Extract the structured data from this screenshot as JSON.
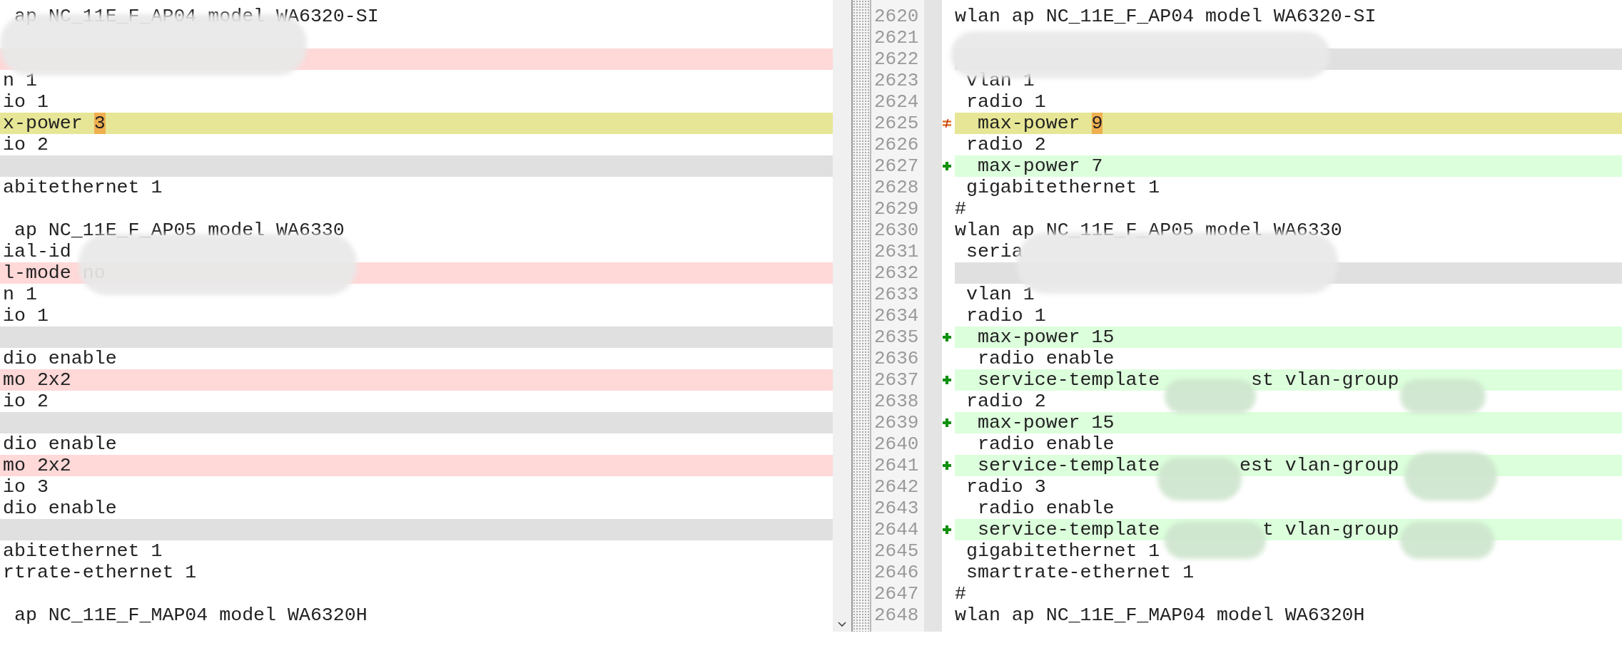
{
  "left_pane": {
    "lines": [
      {
        "kind": "equal",
        "text": " ap NC_11E_F_AP04 model WA6320-SI"
      },
      {
        "kind": "equal"
      },
      {
        "kind": "removed"
      },
      {
        "kind": "equal",
        "text": "n 1"
      },
      {
        "kind": "equal",
        "text": "io 1"
      },
      {
        "kind": "changed",
        "text": "x-power ",
        "changed_text": "3"
      },
      {
        "kind": "equal",
        "text": "io 2"
      },
      {
        "kind": "placeholder"
      },
      {
        "kind": "equal",
        "text": "abitethernet 1"
      },
      {
        "kind": "equal"
      },
      {
        "kind": "equal",
        "text": " ap NC_11E_F_AP05 model WA6330"
      },
      {
        "kind": "equal",
        "text": "ial-id"
      },
      {
        "kind": "removed",
        "text": "l-mode no"
      },
      {
        "kind": "equal",
        "text": "n 1"
      },
      {
        "kind": "equal",
        "text": "io 1"
      },
      {
        "kind": "placeholder"
      },
      {
        "kind": "equal",
        "text": "dio enable"
      },
      {
        "kind": "removed",
        "text": "mo 2x2"
      },
      {
        "kind": "equal",
        "text": "io 2"
      },
      {
        "kind": "placeholder"
      },
      {
        "kind": "equal",
        "text": "dio enable"
      },
      {
        "kind": "removed",
        "text": "mo 2x2"
      },
      {
        "kind": "equal",
        "text": "io 3"
      },
      {
        "kind": "equal",
        "text": "dio enable"
      },
      {
        "kind": "placeholder"
      },
      {
        "kind": "equal",
        "text": "abitethernet 1"
      },
      {
        "kind": "equal",
        "text": "rtrate-ethernet 1"
      },
      {
        "kind": "equal"
      },
      {
        "kind": "equal",
        "text": " ap NC_11E_F_MAP04 model WA6320H"
      }
    ]
  },
  "right_pane": {
    "lines": [
      {
        "number": "2620",
        "kind": "equal",
        "text": "wlan ap NC_11E_F_AP04 model WA6320-SI"
      },
      {
        "number": "2621",
        "kind": "equal"
      },
      {
        "number": "2622",
        "kind": "placeholder"
      },
      {
        "number": "2623",
        "kind": "equal",
        "text": " vlan 1"
      },
      {
        "number": "2624",
        "kind": "equal",
        "text": " radio 1"
      },
      {
        "number": "2625",
        "kind": "changed",
        "text": "  max-power ",
        "changed_text": "9"
      },
      {
        "number": "2626",
        "kind": "equal",
        "text": " radio 2"
      },
      {
        "number": "2627",
        "kind": "added",
        "text": "  max-power 7"
      },
      {
        "number": "2628",
        "kind": "equal",
        "text": " gigabitethernet 1"
      },
      {
        "number": "2629",
        "kind": "equal",
        "text": "#"
      },
      {
        "number": "2630",
        "kind": "equal",
        "text": "wlan ap NC_11E_F_AP05 model WA6330"
      },
      {
        "number": "2631",
        "kind": "equal",
        "text": " seria"
      },
      {
        "number": "2632",
        "kind": "placeholder"
      },
      {
        "number": "2633",
        "kind": "equal",
        "text": " vlan 1"
      },
      {
        "number": "2634",
        "kind": "equal",
        "text": " radio 1"
      },
      {
        "number": "2635",
        "kind": "added",
        "text": "  max-power 15"
      },
      {
        "number": "2636",
        "kind": "equal",
        "text": "  radio enable"
      },
      {
        "number": "2637",
        "kind": "added",
        "text": "  service-template        st vlan-group"
      },
      {
        "number": "2638",
        "kind": "equal",
        "text": " radio 2"
      },
      {
        "number": "2639",
        "kind": "added",
        "text": "  max-power 15"
      },
      {
        "number": "2640",
        "kind": "equal",
        "text": "  radio enable"
      },
      {
        "number": "2641",
        "kind": "added",
        "text": "  service-template       est vlan-group"
      },
      {
        "number": "2642",
        "kind": "equal",
        "text": " radio 3"
      },
      {
        "number": "2643",
        "kind": "equal",
        "text": "  radio enable"
      },
      {
        "number": "2644",
        "kind": "added",
        "text": "  service-template         t vlan-group"
      },
      {
        "number": "2645",
        "kind": "equal",
        "text": " gigabitethernet 1"
      },
      {
        "number": "2646",
        "kind": "equal",
        "text": " smartrate-ethernet 1"
      },
      {
        "number": "2647",
        "kind": "equal",
        "text": "#"
      },
      {
        "number": "2648",
        "kind": "equal",
        "text": "wlan ap NC_11E_F_MAP04 model WA6320H"
      }
    ]
  }
}
